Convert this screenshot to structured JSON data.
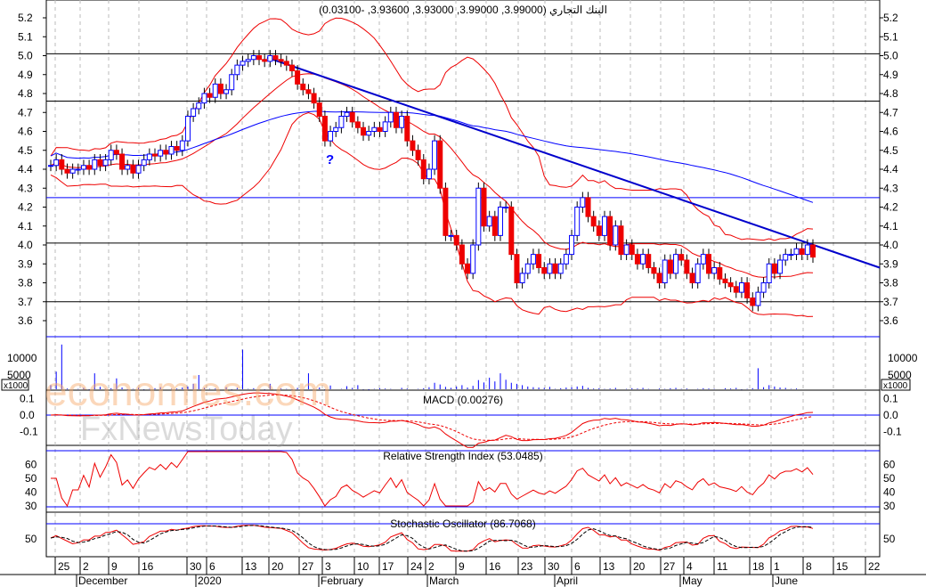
{
  "chart_data": {
    "type": "candlestick",
    "title": "البنك التجاري (3.99000, 3.99000, 3.93000, 3.93600, -0.03100)",
    "price_axis": {
      "ticks": [
        "5.2",
        "5.1",
        "5.0",
        "4.9",
        "4.8",
        "4.7",
        "4.6",
        "4.5",
        "4.4",
        "4.3",
        "4.2",
        "4.1",
        "4.0",
        "3.9",
        "3.8",
        "3.7",
        "3.6"
      ],
      "range": [
        3.52,
        5.26
      ]
    },
    "horizontal_levels": {
      "black": [
        5.01,
        4.76,
        4.01,
        3.7
      ],
      "blue": [
        4.25
      ]
    },
    "trendline": {
      "from": 4.99,
      "to": 3.88
    },
    "closes": [
      4.42,
      4.45,
      4.4,
      4.38,
      4.4,
      4.4,
      4.42,
      4.4,
      4.45,
      4.42,
      4.45,
      4.5,
      4.48,
      4.4,
      4.42,
      4.38,
      4.42,
      4.45,
      4.48,
      4.47,
      4.5,
      4.48,
      4.52,
      4.5,
      4.55,
      4.68,
      4.72,
      4.75,
      4.8,
      4.78,
      4.85,
      4.8,
      4.82,
      4.9,
      4.95,
      4.97,
      4.98,
      5.0,
      4.98,
      4.97,
      5.0,
      4.98,
      4.97,
      4.95,
      4.92,
      4.85,
      4.82,
      4.8,
      4.75,
      4.68,
      4.55,
      4.6,
      4.62,
      4.68,
      4.7,
      4.65,
      4.62,
      4.58,
      4.6,
      4.62,
      4.6,
      4.65,
      4.7,
      4.62,
      4.68,
      4.55,
      4.5,
      4.45,
      4.35,
      4.4,
      4.55,
      4.3,
      4.05,
      4.05,
      4.0,
      3.9,
      3.85,
      4.0,
      4.3,
      4.1,
      4.15,
      4.05,
      4.2,
      4.2,
      3.95,
      3.8,
      3.85,
      3.9,
      3.95,
      3.88,
      3.85,
      3.9,
      3.85,
      3.9,
      3.95,
      4.05,
      4.2,
      4.25,
      4.15,
      4.1,
      4.05,
      4.15,
      4.0,
      4.1,
      3.95,
      4.0,
      3.95,
      3.9,
      3.95,
      3.88,
      3.85,
      3.8,
      3.92,
      3.85,
      3.95,
      3.92,
      3.85,
      3.8,
      3.9,
      3.95,
      3.85,
      3.88,
      3.82,
      3.8,
      3.78,
      3.75,
      3.8,
      3.72,
      3.68,
      3.75,
      3.8,
      3.9,
      3.85,
      3.92,
      3.95,
      3.95,
      3.98,
      3.95,
      4.0,
      3.936
    ],
    "volume": {
      "unit_label": "x1000",
      "ticks": [
        "10000",
        "5000"
      ],
      "values": [
        2000,
        6000,
        14000,
        1000,
        800,
        900,
        1200,
        700,
        5500,
        1500,
        900,
        1100,
        4000,
        1300,
        600,
        900,
        1200,
        700,
        900,
        1100,
        1400,
        800,
        900,
        1000,
        1300,
        1600,
        2400,
        5000,
        1200,
        900,
        1000,
        800,
        1400,
        700,
        1200,
        12500,
        900,
        1100,
        800,
        700,
        2400,
        800,
        1000,
        900,
        600,
        1200,
        800,
        5500,
        900,
        1300,
        700,
        1900,
        800,
        900,
        1700,
        1200,
        2000,
        700,
        600,
        900,
        1100,
        1000,
        900,
        800,
        1200,
        1000,
        800,
        900,
        1100,
        1400,
        2700,
        2200,
        1500,
        1200,
        1600,
        2000,
        1300,
        1800,
        3500,
        2800,
        4200,
        3100,
        5500,
        3600,
        2700,
        2400,
        2000,
        1600,
        1400,
        1300,
        1200,
        1500,
        900,
        1100,
        1300,
        1400,
        1600,
        1800,
        1200,
        1000,
        1100,
        900,
        1000,
        1200,
        800,
        900,
        1100,
        1000,
        1200,
        900,
        800,
        1000,
        900,
        1100,
        1200,
        900,
        1000,
        800,
        900,
        1100,
        1000,
        900,
        800,
        1100,
        1000,
        1200,
        700,
        900,
        1100,
        7000,
        1400,
        2000,
        1600,
        1300,
        1200,
        900,
        1000,
        800
      ]
    },
    "macd": {
      "label": "MACD (0.00276)",
      "ticks": [
        "0.1",
        "0.0",
        "-0.1"
      ]
    },
    "rsi": {
      "label": "Relative Strength Index (53.0485)",
      "ticks": [
        "60",
        "50",
        "40",
        "30"
      ]
    },
    "stochastic": {
      "label": "Stochastic Oscillator (86.7068)",
      "ticks": [
        "50"
      ]
    },
    "date_ticks": [
      "25",
      "2",
      "9",
      "16",
      "30",
      "6",
      "13",
      "20",
      "27",
      "3",
      "10",
      "17",
      "24",
      "2",
      "9",
      "16",
      "23",
      "30",
      "6",
      "13",
      "20",
      "27",
      "4",
      "11",
      "18",
      "1",
      "8",
      "15",
      "22"
    ],
    "months": [
      "December",
      "2020",
      "February",
      "March",
      "April",
      "May",
      "June"
    ],
    "annotation": "?"
  },
  "watermark": {
    "line1": "economies.com",
    "line2": "FxNewsToday"
  }
}
